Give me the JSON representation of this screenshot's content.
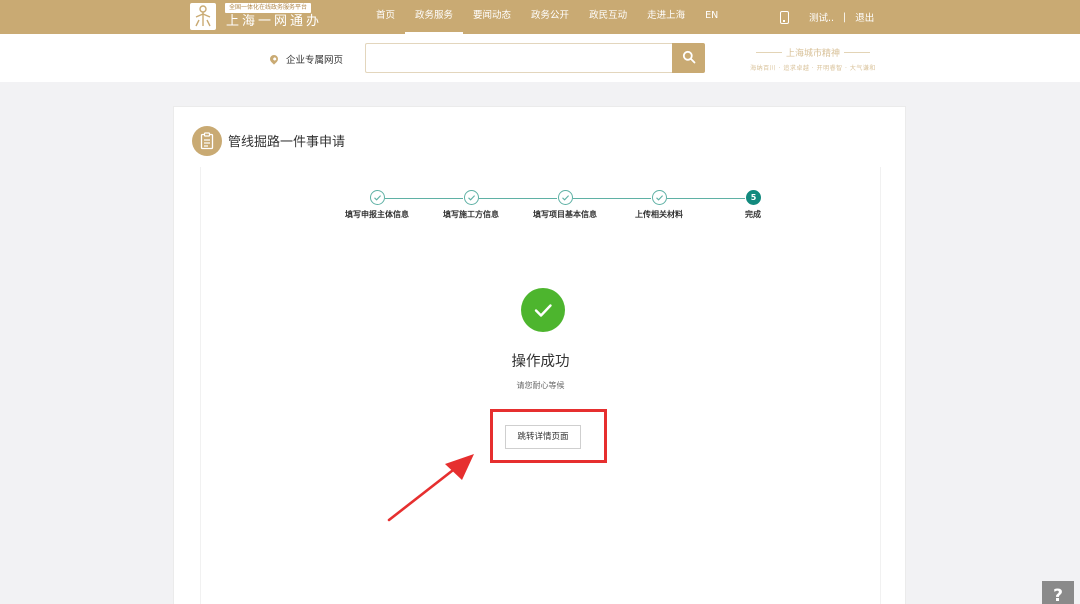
{
  "header": {
    "logo_tag": "全国一体化在线政务服务平台",
    "logo_title": "上海一网通办",
    "nav": [
      "首页",
      "政务服务",
      "要闻动态",
      "政务公开",
      "政民互动",
      "走进上海",
      "EN"
    ],
    "nav_active_index": 1,
    "user_name": "测试..",
    "separator": "|",
    "logout": "退出"
  },
  "search": {
    "location_label": "企业专属网页",
    "placeholder": "",
    "city_brand_title": "上海城市精神",
    "city_brand_sub": "海纳百川 · 追求卓越 · 开明睿智 · 大气谦和"
  },
  "panel": {
    "title": "管线掘路一件事申请"
  },
  "steps": [
    {
      "label": "填写申报主体信息",
      "state": "done"
    },
    {
      "label": "填写施工方信息",
      "state": "done"
    },
    {
      "label": "填写项目基本信息",
      "state": "done"
    },
    {
      "label": "上传相关材料",
      "state": "done"
    },
    {
      "label": "完成",
      "state": "active",
      "number": "5"
    }
  ],
  "result": {
    "title": "操作成功",
    "subtitle": "请您耐心等候",
    "detail_button": "跳转详情页面"
  },
  "help": "?",
  "colors": {
    "brand_gold": "#c9aa73",
    "step_teal": "#5fb1a5",
    "step_active": "#138a7e",
    "success_green": "#4db52e",
    "annotation_red": "#e62f2f"
  }
}
